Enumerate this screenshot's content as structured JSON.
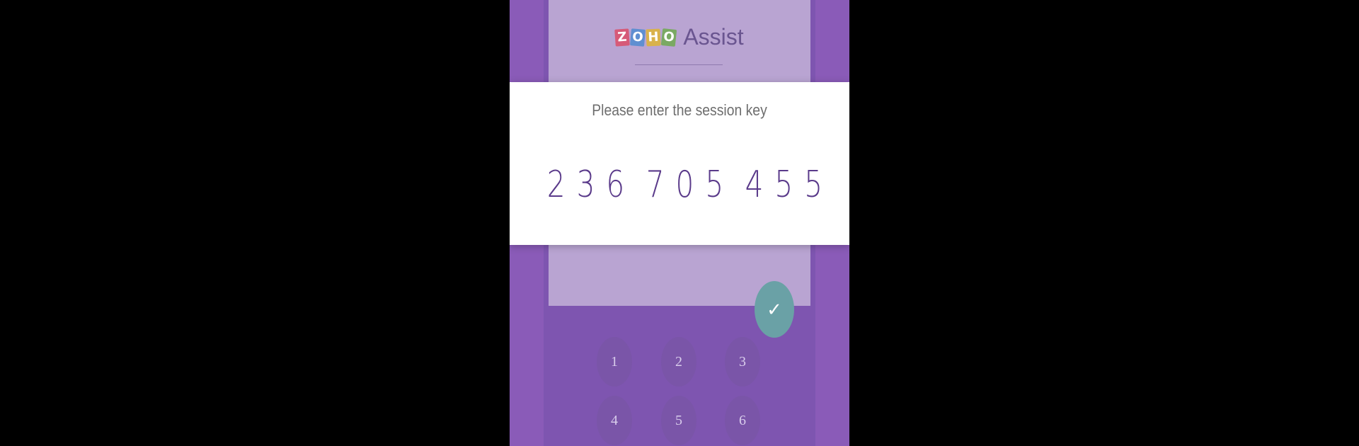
{
  "logo": {
    "letters": [
      "Z",
      "O",
      "H",
      "O"
    ],
    "letter_colors": [
      "#d65a78",
      "#5f8fd1",
      "#d9b24b",
      "#7aa963"
    ],
    "product": "Assist"
  },
  "dialog": {
    "title": "Please enter the session key",
    "session_key": "2 3 6  7 0 5  4 5 5"
  },
  "confirm": {
    "icon": "check-icon",
    "glyph": "✓"
  },
  "keypad": {
    "keys": [
      "1",
      "2",
      "3",
      "4",
      "5",
      "6"
    ]
  }
}
